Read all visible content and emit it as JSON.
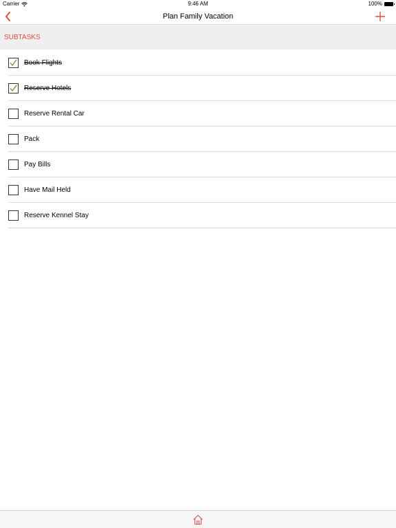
{
  "status_bar": {
    "carrier": "Carrier",
    "time": "9:46 AM",
    "battery": "100%"
  },
  "nav": {
    "title": "Plan Family Vacation",
    "back_icon": "chevron-left-icon",
    "add_icon": "plus-icon"
  },
  "section": {
    "header": "SUBTASKS"
  },
  "tasks": [
    {
      "label": "Book Flights",
      "checked": true
    },
    {
      "label": "Reserve Hotels",
      "checked": true
    },
    {
      "label": "Reserve Rental Car",
      "checked": false
    },
    {
      "label": "Pack",
      "checked": false
    },
    {
      "label": "Pay Bills",
      "checked": false
    },
    {
      "label": "Have Mail Held",
      "checked": false
    },
    {
      "label": "Reserve Kennel Stay",
      "checked": false
    }
  ],
  "toolbar": {
    "home_icon": "home-icon"
  },
  "colors": {
    "accent": "#e04b3a",
    "check": "#6b8e23",
    "section_bg": "#efefef"
  }
}
